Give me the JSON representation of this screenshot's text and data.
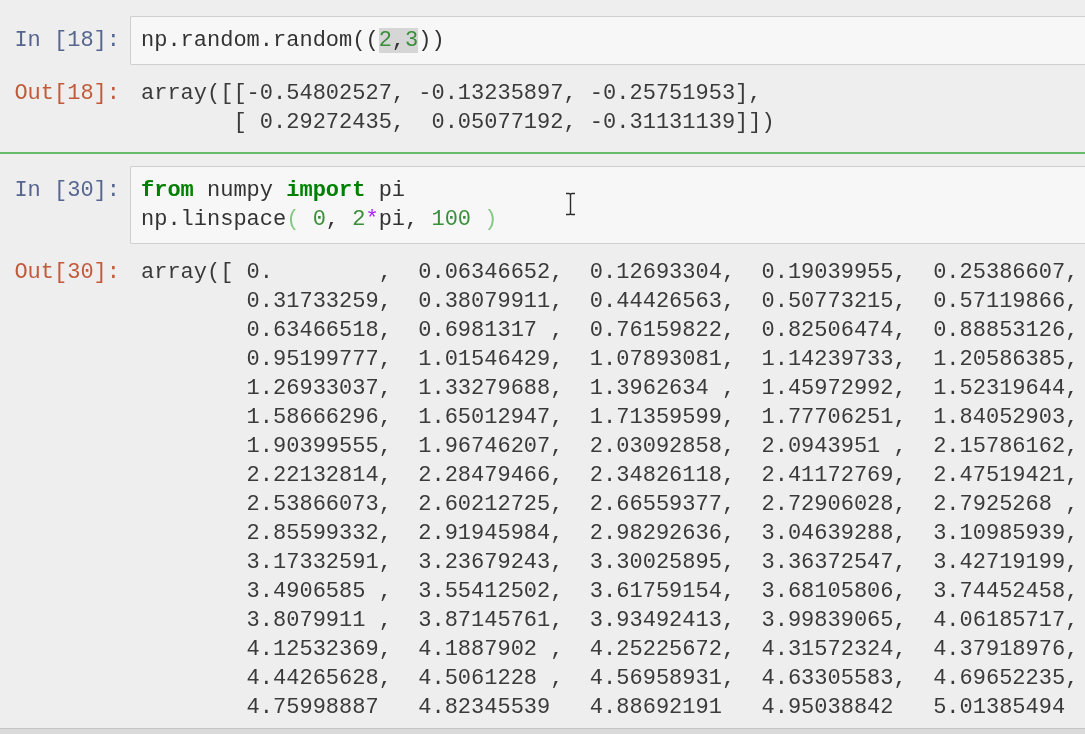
{
  "cells": [
    {
      "selected": false,
      "input_prompt": "In [18]:",
      "code": [
        [
          {
            "kind": "plain",
            "text": "np.random.random((",
            "highlighted": false
          },
          {
            "kind": "number",
            "text": "2",
            "highlighted": true
          },
          {
            "kind": "plain",
            "text": ",",
            "highlighted": true
          },
          {
            "kind": "number",
            "text": "3",
            "highlighted": true
          },
          {
            "kind": "plain",
            "text": "))",
            "highlighted": false
          }
        ]
      ],
      "output_prompt": "Out[18]:",
      "output": [
        "array([[-0.54802527, -0.13235897, -0.25751953],",
        "       [ 0.29272435,  0.05077192, -0.31131139]])"
      ]
    },
    {
      "selected": true,
      "input_prompt": "In [30]:",
      "code": [
        [
          {
            "kind": "keyword",
            "text": "from",
            "highlighted": false
          },
          {
            "kind": "plain",
            "text": " numpy ",
            "highlighted": false
          },
          {
            "kind": "keyword",
            "text": "import",
            "highlighted": false
          },
          {
            "kind": "plain",
            "text": " pi",
            "highlighted": false
          }
        ],
        [
          {
            "kind": "plain",
            "text": "np.linspace",
            "highlighted": false
          },
          {
            "kind": "bracket",
            "text": "( ",
            "highlighted": false
          },
          {
            "kind": "number",
            "text": "0",
            "highlighted": false
          },
          {
            "kind": "plain",
            "text": ", ",
            "highlighted": false
          },
          {
            "kind": "number",
            "text": "2",
            "highlighted": false
          },
          {
            "kind": "operator",
            "text": "*",
            "highlighted": false
          },
          {
            "kind": "plain",
            "text": "pi, ",
            "highlighted": false
          },
          {
            "kind": "number",
            "text": "100",
            "highlighted": false
          },
          {
            "kind": "bracket",
            "text": " )",
            "highlighted": false
          }
        ]
      ],
      "output_prompt": "Out[30]:",
      "output": [
        "array([ 0.        ,  0.06346652,  0.12693304,  0.19039955,  0.25386607,",
        "        0.31733259,  0.38079911,  0.44426563,  0.50773215,  0.57119866,",
        "        0.63466518,  0.6981317 ,  0.76159822,  0.82506474,  0.88853126,",
        "        0.95199777,  1.01546429,  1.07893081,  1.14239733,  1.20586385,",
        "        1.26933037,  1.33279688,  1.3962634 ,  1.45972992,  1.52319644,",
        "        1.58666296,  1.65012947,  1.71359599,  1.77706251,  1.84052903,",
        "        1.90399555,  1.96746207,  2.03092858,  2.0943951 ,  2.15786162,",
        "        2.22132814,  2.28479466,  2.34826118,  2.41172769,  2.47519421,",
        "        2.53866073,  2.60212725,  2.66559377,  2.72906028,  2.7925268 ,",
        "        2.85599332,  2.91945984,  2.98292636,  3.04639288,  3.10985939,",
        "        3.17332591,  3.23679243,  3.30025895,  3.36372547,  3.42719199,",
        "        3.4906585 ,  3.55412502,  3.61759154,  3.68105806,  3.74452458,",
        "        3.8079911 ,  3.87145761,  3.93492413,  3.99839065,  4.06185717,",
        "        4.12532369,  4.1887902 ,  4.25225672,  4.31572324,  4.37918976,",
        "        4.44265628,  4.5061228 ,  4.56958931,  4.63305583,  4.69652235,",
        "        4.75998887   4.82345539   4.88692191   4.95038842   5.01385494"
      ]
    }
  ]
}
